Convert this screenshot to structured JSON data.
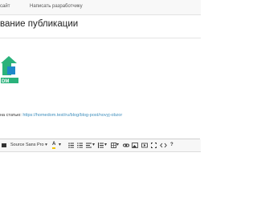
{
  "nav": {
    "item_1": "сайт",
    "item_2": "Написать разработчику"
  },
  "page": {
    "title": "вание публикации"
  },
  "article": {
    "link_label": "на статью:",
    "link_url": "https://homedom.test/ru/blog/blog-post/novyj-obzor"
  },
  "toolbar": {
    "font_family": "Source Sans Pro",
    "font_color_label": "A",
    "help_label": "?"
  },
  "colors": {
    "accent": "#3c8dbc",
    "logo_green": "#2ab27b",
    "logo_blue": "#1e88c9"
  }
}
